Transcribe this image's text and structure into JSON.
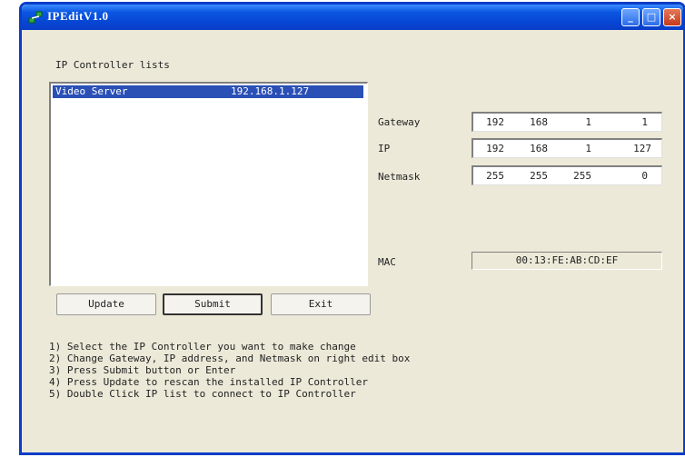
{
  "window": {
    "title": "IPEditV1.0"
  },
  "titlebar_buttons": {
    "minimize": "_",
    "maximize": "□",
    "close": "×"
  },
  "list_section": {
    "label": "IP Controller lists",
    "items": [
      {
        "name": "Video Server",
        "ip": "192.168.1.127",
        "selected": true
      }
    ]
  },
  "fields": {
    "gateway": {
      "label": "Gateway",
      "octets": [
        "192",
        "168",
        "1",
        "1"
      ]
    },
    "ip": {
      "label": "IP",
      "octets": [
        "192",
        "168",
        "1",
        "127"
      ]
    },
    "netmask": {
      "label": "Netmask",
      "octets": [
        "255",
        "255",
        "255",
        "0"
      ]
    },
    "mac": {
      "label": "MAC",
      "value": "00:13:FE:AB:CD:EF"
    }
  },
  "buttons": {
    "update": "Update",
    "submit": "Submit",
    "exit": "Exit"
  },
  "instructions": [
    "1) Select the IP Controller you want to make change",
    "2) Change Gateway, IP address, and Netmask on right edit box",
    "3) Press Submit button or Enter",
    "4) Press Update to rescan the installed IP Controller",
    "5) Double Click IP list to connect to IP Controller"
  ],
  "colors": {
    "titlebar": "#0a3dc8",
    "window_bg": "#ece9d8",
    "selection": "#2a50b6"
  }
}
